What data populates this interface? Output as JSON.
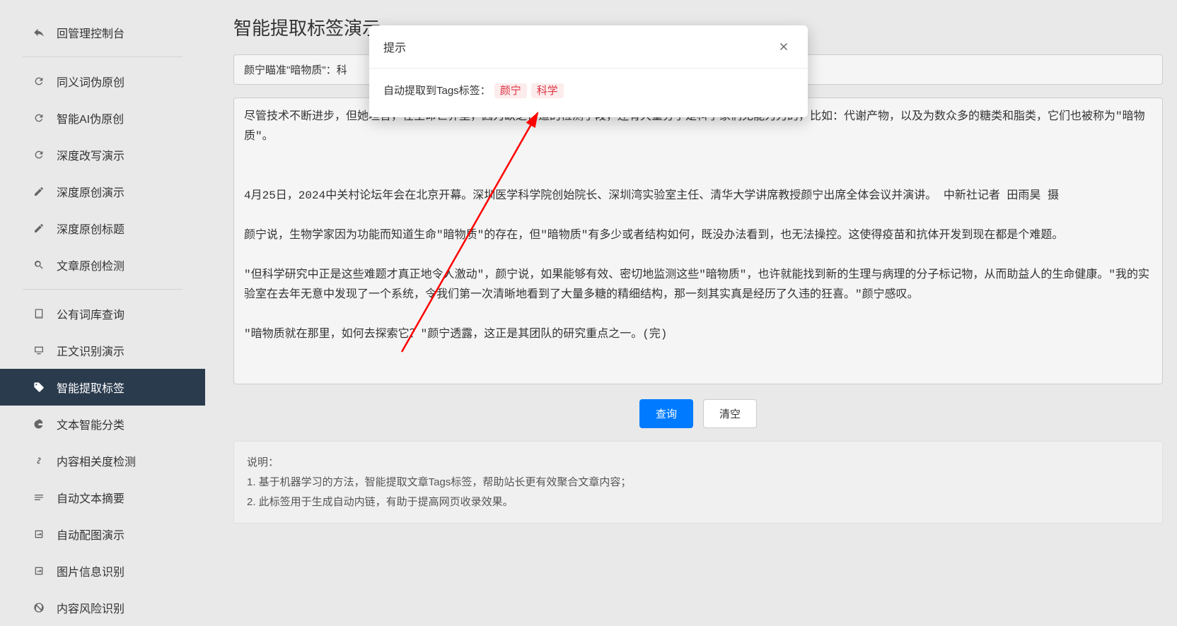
{
  "sidebar": {
    "back_label": "回管理控制台",
    "items_g1": [
      {
        "label": "同义词伪原创",
        "icon": "refresh"
      },
      {
        "label": "智能AI伪原创",
        "icon": "refresh"
      },
      {
        "label": "深度改写演示",
        "icon": "refresh"
      },
      {
        "label": "深度原创演示",
        "icon": "edit"
      },
      {
        "label": "深度原创标题",
        "icon": "edit"
      },
      {
        "label": "文章原创检测",
        "icon": "search"
      }
    ],
    "items_g2": [
      {
        "label": "公有词库查询",
        "icon": "book"
      },
      {
        "label": "正文识别演示",
        "icon": "monitor"
      },
      {
        "label": "智能提取标签",
        "icon": "tag",
        "active": true
      },
      {
        "label": "文本智能分类",
        "icon": "pie"
      },
      {
        "label": "内容相关度检测",
        "icon": "link"
      },
      {
        "label": "自动文本摘要",
        "icon": "bars"
      },
      {
        "label": "自动配图演示",
        "icon": "image"
      },
      {
        "label": "图片信息识别",
        "icon": "image"
      },
      {
        "label": "内容风险识别",
        "icon": "ban"
      }
    ]
  },
  "main": {
    "page_title": "智能提取标签演示",
    "title_input_value": "颜宁瞄准\"暗物质\"：科",
    "content_value": "尽管技术不断进步，但她坦言，在生命世界里，因为缺乏合适的检测手段，还有大量分子是科学家们无能为力的，比如：代谢产物，以及为数众多的糖类和脂类，它们也被称为\"暗物质\"。\n\n\n4月25日，2024中关村论坛年会在北京开幕。深圳医学科学院创始院长、深圳湾实验室主任、清华大学讲席教授颜宁出席全体会议并演讲。 中新社记者 田雨昊 摄\n\n颜宁说，生物学家因为功能而知道生命\"暗物质\"的存在，但\"暗物质\"有多少或者结构如何，既没办法看到，也无法操控。这使得疫苗和抗体开发到现在都是个难题。\n\n\"但科学研究中正是这些难题才真正地令人激动\"，颜宁说，如果能够有效、密切地监测这些\"暗物质\"，也许就能找到新的生理与病理的分子标记物，从而助益人的生命健康。\"我的实验室在去年无意中发现了一个系统，令我们第一次清晰地看到了大量多糖的精细结构，那一刻其实真是经历了久违的狂喜。\"颜宁感叹。\n\n\"暗物质就在那里，如何去探索它？\"颜宁透露，这正是其团队的研究重点之一。(完)",
    "query_btn": "查询",
    "clear_btn": "清空",
    "desc_heading": "说明：",
    "desc_line1": "1. 基于机器学习的方法，智能提取文章Tags标签，帮助站长更有效聚合文章内容；",
    "desc_line2": "2. 此标签用于生成自动内链，有助于提高网页收录效果。"
  },
  "modal": {
    "title": "提示",
    "body_prefix": "自动提取到Tags标签：",
    "tags": [
      "颜宁",
      "科学"
    ]
  },
  "colors": {
    "primary": "#007bff",
    "danger": "#dc3545",
    "sidebar_active": "#2b3b4e"
  }
}
